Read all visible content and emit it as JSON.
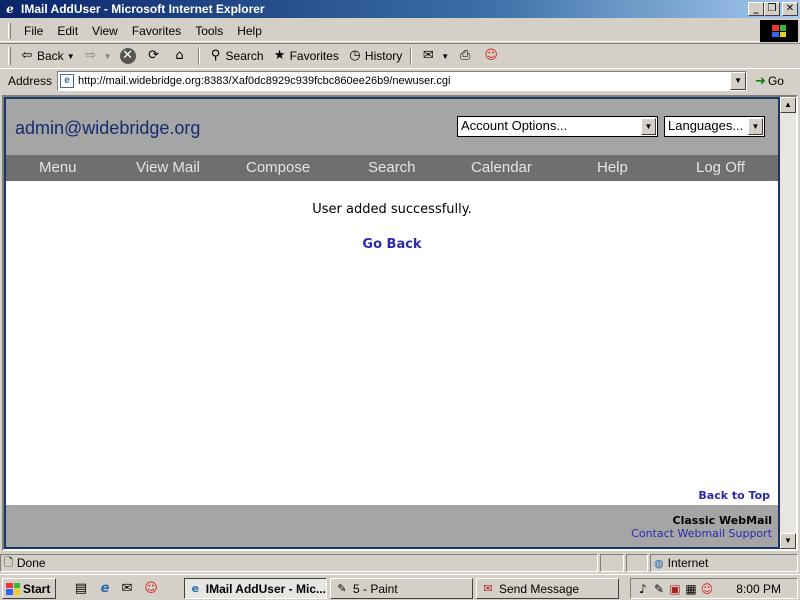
{
  "window": {
    "title": "IMail AddUser - Microsoft Internet Explorer",
    "controls": {
      "minimize": "_",
      "maximize": "❐",
      "close": "✕"
    }
  },
  "menu": [
    "File",
    "Edit",
    "View",
    "Favorites",
    "Tools",
    "Help"
  ],
  "toolbar": {
    "back": "Back",
    "search": "Search",
    "favorites": "Favorites",
    "history": "History"
  },
  "address": {
    "label": "Address",
    "url": "http://mail.widebridge.org:8383/Xaf0dc8929c939fcbc860ee26b9/newuser.cgi",
    "go": "Go"
  },
  "webmail": {
    "user_email": "admin@widebridge.org",
    "account_options": "Account Options...",
    "languages": "Languages...",
    "nav": [
      "Menu",
      "View Mail",
      "Compose",
      "Search",
      "Calendar",
      "Help",
      "Log Off"
    ],
    "message": "User added successfully.",
    "go_back": "Go Back",
    "back_to_top": "Back to Top",
    "footer_brand": "Classic WebMail",
    "footer_support": "Contact Webmail Support",
    "colors": {
      "frame": "#173769",
      "band": "#a5a5a5",
      "nav": "#6f6f6f",
      "link": "#2a2ab0"
    }
  },
  "status": {
    "text": "Done",
    "zone": "Internet"
  },
  "taskbar": {
    "start": "Start",
    "tasks": [
      "IMail AddUser - Mic...",
      "5 - Paint",
      "Send Message"
    ],
    "clock": "8:00 PM"
  },
  "icons": {
    "back": "back-arrow-icon",
    "forward": "forward-arrow-icon",
    "stop": "stop-icon",
    "refresh": "refresh-icon",
    "home": "home-icon",
    "search": "search-icon",
    "favorites": "favorites-icon",
    "history": "history-icon",
    "mail": "mail-icon",
    "print": "print-icon",
    "messenger": "messenger-icon"
  }
}
